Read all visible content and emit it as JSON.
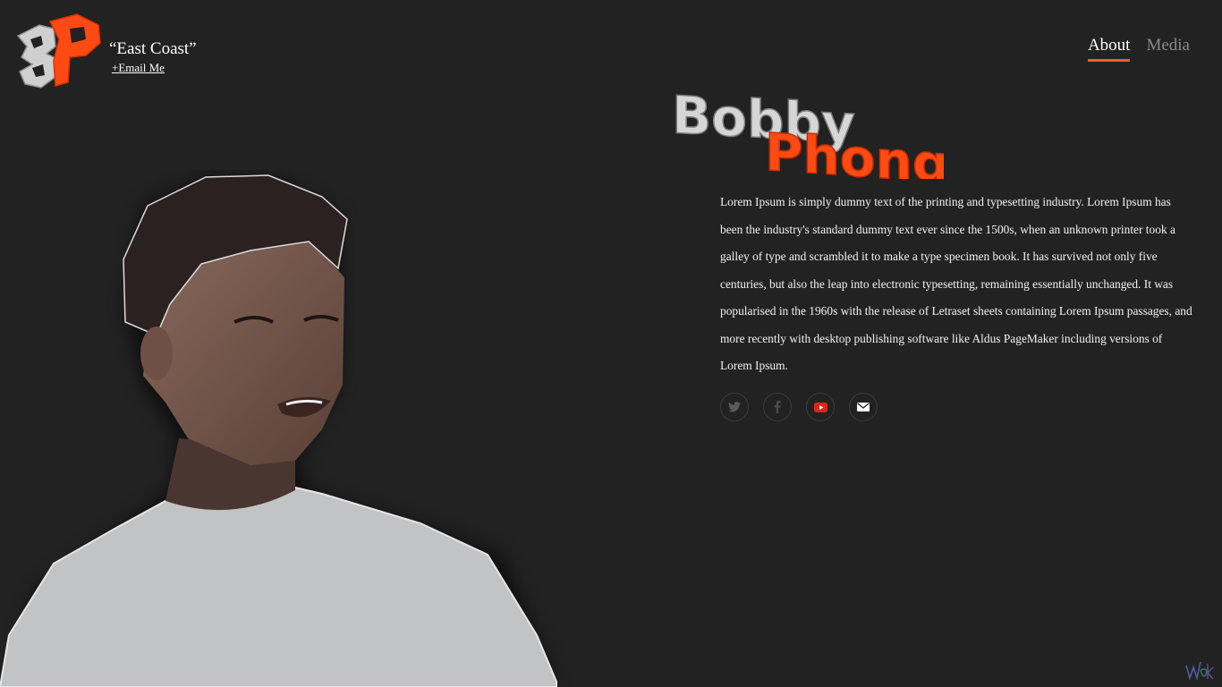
{
  "header": {
    "tagline": "“East Coast”",
    "email_link": "+Email Me"
  },
  "nav": {
    "items": [
      {
        "label": "About",
        "active": true
      },
      {
        "label": "Media",
        "active": false
      }
    ]
  },
  "profile": {
    "first_name": "Bobby",
    "last_name": "Phong",
    "bio": "Lorem Ipsum is simply dummy text of the printing and typesetting industry. Lorem Ipsum has been the industry's standard dummy text ever since the 1500s, when an unknown printer took a galley of type and scrambled it to make a type specimen book. It has survived not only five centuries, but also the leap into electronic typesetting, remaining essentially unchanged. It was popularised in the 1960s with the release of Letraset sheets containing Lorem Ipsum passages, and more recently with desktop publishing software like Aldus PageMaker including versions of Lorem Ipsum."
  },
  "social": [
    {
      "icon": "twitter-icon"
    },
    {
      "icon": "facebook-icon"
    },
    {
      "icon": "youtube-icon"
    },
    {
      "icon": "mail-icon"
    }
  ],
  "colors": {
    "background": "#222222",
    "accent": "#ff5a1f",
    "nav_inactive": "#8a8a8a"
  }
}
